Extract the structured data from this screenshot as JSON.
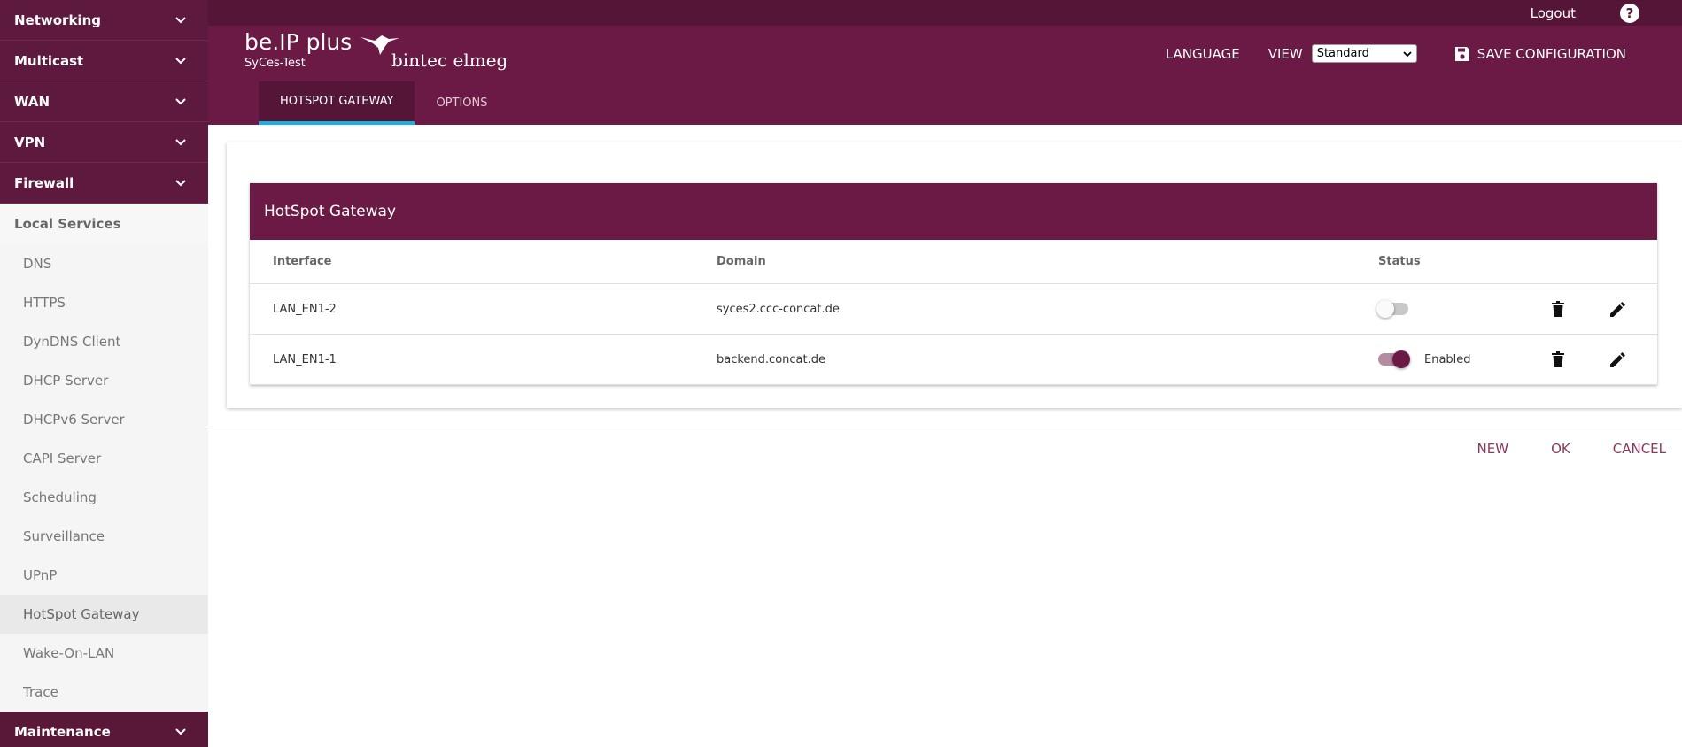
{
  "sidebar": {
    "top_groups": [
      {
        "label": "Networking"
      },
      {
        "label": "Multicast"
      },
      {
        "label": "WAN"
      },
      {
        "label": "VPN"
      },
      {
        "label": "Firewall"
      }
    ],
    "section": "Local Services",
    "items": [
      {
        "label": "DNS"
      },
      {
        "label": "HTTPS"
      },
      {
        "label": "DynDNS Client"
      },
      {
        "label": "DHCP Server"
      },
      {
        "label": "DHCPv6 Server"
      },
      {
        "label": "CAPI Server"
      },
      {
        "label": "Scheduling"
      },
      {
        "label": "Surveillance"
      },
      {
        "label": "UPnP"
      },
      {
        "label": "HotSpot Gateway"
      },
      {
        "label": "Wake-On-LAN"
      },
      {
        "label": "Trace"
      }
    ],
    "bottom_group": "Maintenance"
  },
  "header": {
    "logout": "Logout",
    "help": "?",
    "product": "be.IP plus",
    "device": "SyCes-Test",
    "logo_text": "bintec elmeg",
    "language": "LANGUAGE",
    "view": "VIEW",
    "view_value": "Standard",
    "save": "SAVE CONFIGURATION",
    "tabs": [
      {
        "label": "HOTSPOT GATEWAY"
      },
      {
        "label": "OPTIONS"
      }
    ]
  },
  "panel": {
    "title": "HotSpot Gateway",
    "columns": {
      "interface": "Interface",
      "domain": "Domain",
      "status": "Status"
    },
    "rows": [
      {
        "interface": "LAN_EN1-2",
        "domain": "syces2.ccc-concat.de",
        "status": ""
      },
      {
        "interface": "LAN_EN1-1",
        "domain": "backend.concat.de",
        "status": "Enabled"
      }
    ]
  },
  "actions": {
    "new": "NEW",
    "ok": "OK",
    "cancel": "CANCEL"
  },
  "colors": {
    "brand": "#6b1a46",
    "brand_dark": "#541537",
    "tab_accent": "#18b0e0"
  }
}
